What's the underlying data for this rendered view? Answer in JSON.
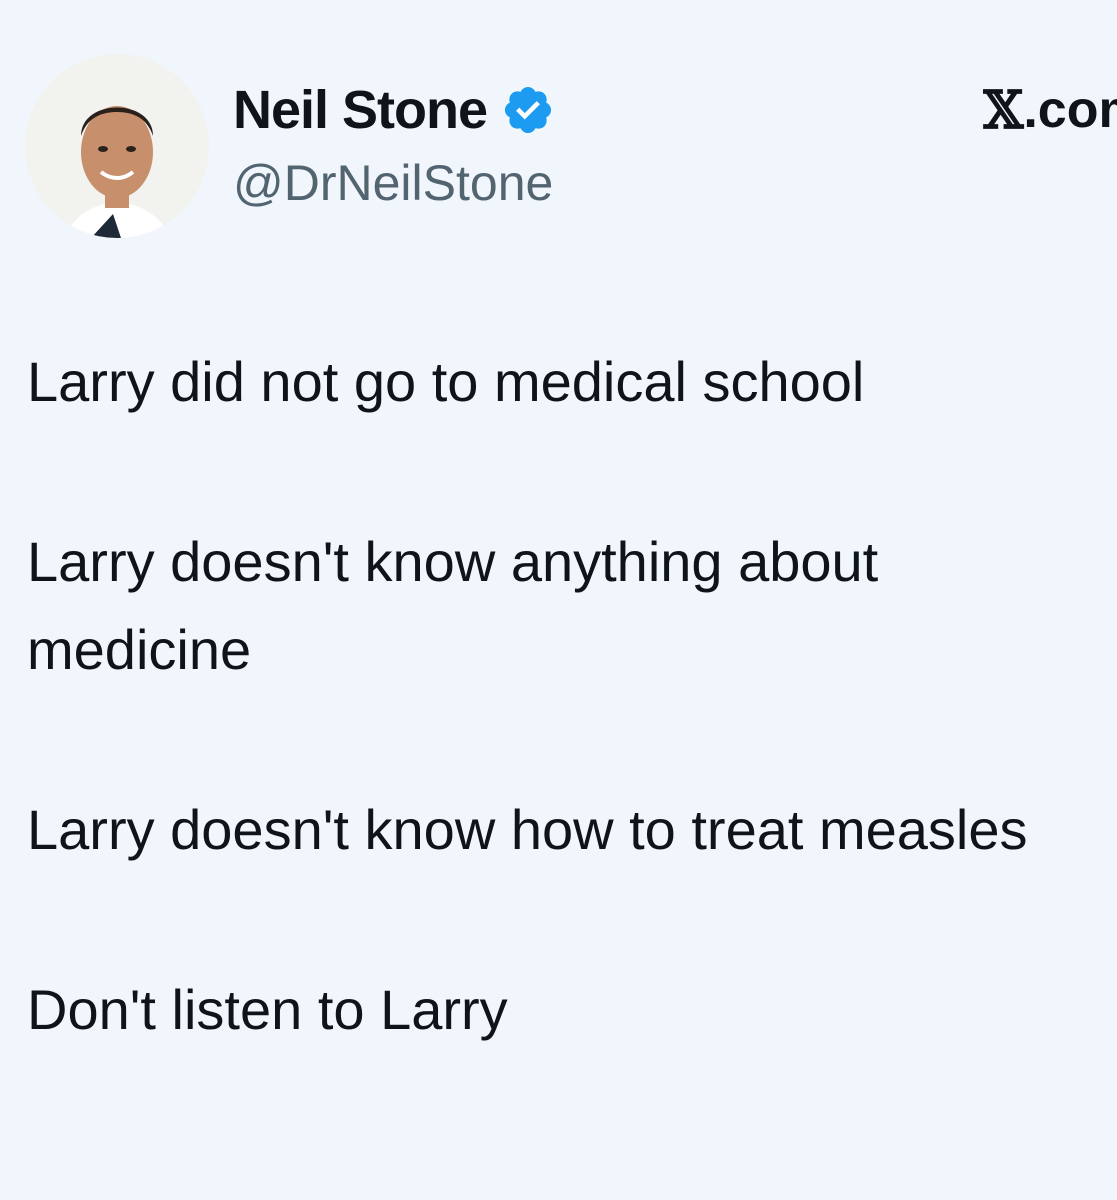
{
  "author": {
    "display_name": "Neil Stone",
    "handle": "@DrNeilStone",
    "verified": true,
    "verified_color": "#1d9bf0"
  },
  "site": {
    "logo_glyph": "𝕏",
    "domain": ".com"
  },
  "tweet": {
    "lines": [
      "Larry did not go to medical school",
      "Larry doesn't know anything about medicine",
      "Larry doesn't know how to treat measles",
      "Don't listen to Larry"
    ]
  },
  "colors": {
    "background": "#f0f6fc",
    "text": "#0f1419",
    "secondary_text": "#536471"
  }
}
